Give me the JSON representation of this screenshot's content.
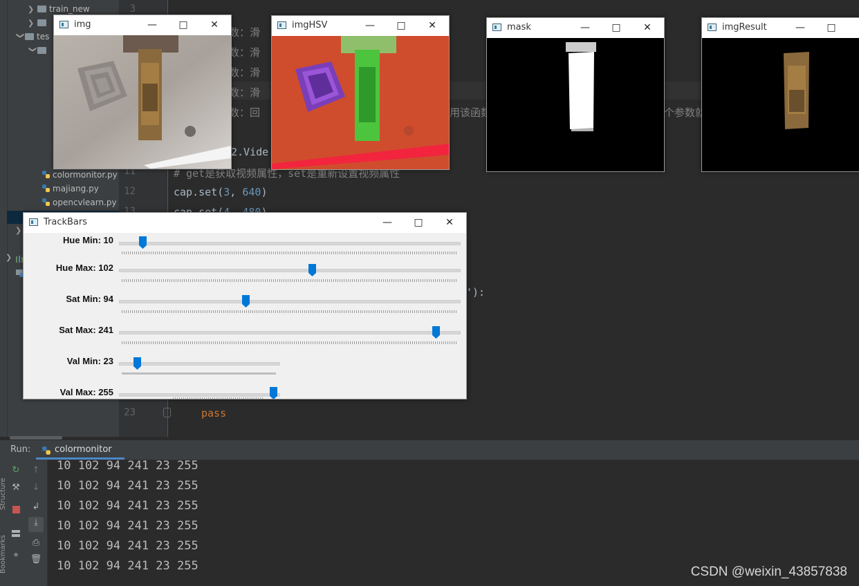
{
  "project_tree": {
    "rows": [
      {
        "label": "train_new",
        "kind": "folder"
      },
      {
        "label": "",
        "kind": "folder"
      },
      {
        "label": "tes",
        "kind": "folder"
      },
      {
        "label": "",
        "kind": "folder"
      }
    ],
    "files": [
      "colormonitor.py",
      "majiang.py",
      "opencvlearn.py"
    ]
  },
  "editor": {
    "line_numbers": {
      "l3": "3",
      "l11": "11",
      "l12": "12",
      "l13": "13",
      "l23": "23"
    },
    "visible_text": {
      "param1": "参数：滑",
      "param2": "参数：滑",
      "param3": "参数：滑",
      "param4": "参数：滑",
      "param5": "参数：回",
      "param5_tail": "用该函数",
      "param5_tail2": "个参数就",
      "video_line": "2.Vide",
      "comment_line": "# get是获取视频属性，set是重新设置视频属性",
      "cap_set_3": "cap.set(",
      "cap_set_3_args_a": "3",
      "cap_set_3_args_b": ", ",
      "cap_set_3_args_c": "640",
      "cap_set_3_close": ")",
      "cap_set_4": "cap.set(",
      "cap_set_4_args_a": "4",
      "cap_set_4_args_b": ", ",
      "cap_set_4_args_c": "480",
      "cap_set_4_close": ")",
      "quote_tail": "'):",
      "pass_kw": "pass"
    }
  },
  "windows": {
    "img": {
      "title": "img"
    },
    "imgHSV": {
      "title": "imgHSV"
    },
    "mask": {
      "title": "mask"
    },
    "imgResult": {
      "title": "imgResult"
    },
    "trackbars": {
      "title": "TrackBars"
    }
  },
  "trackbars": [
    {
      "label": "Hue Min: 10",
      "value": 10,
      "max": 179
    },
    {
      "label": "Hue Max: 102",
      "value": 102,
      "max": 179
    },
    {
      "label": "Sat Min: 94",
      "value": 94,
      "max": 255
    },
    {
      "label": "Sat Max: 241",
      "value": 241,
      "max": 255
    },
    {
      "label": "Val Min: 23",
      "value": 23,
      "max": 255
    },
    {
      "label": "Val Max: 255",
      "value": 255,
      "max": 255
    }
  ],
  "run_panel": {
    "label": "Run:",
    "tab": "colormonitor",
    "output": [
      "10 102 94 241 23 255",
      "10 102 94 241 23 255",
      "10 102 94 241 23 255",
      "10 102 94 241 23 255",
      "10 102 94 241 23 255",
      "10 102 94 241 23 255"
    ],
    "side_labels": [
      "Structure",
      "Bookmarks"
    ]
  },
  "watermark": "CSDN @weixin_43857838",
  "colors": {
    "accent": "#0078d7",
    "ide_bg": "#2b2b2b",
    "panel_bg": "#3c3f41"
  }
}
